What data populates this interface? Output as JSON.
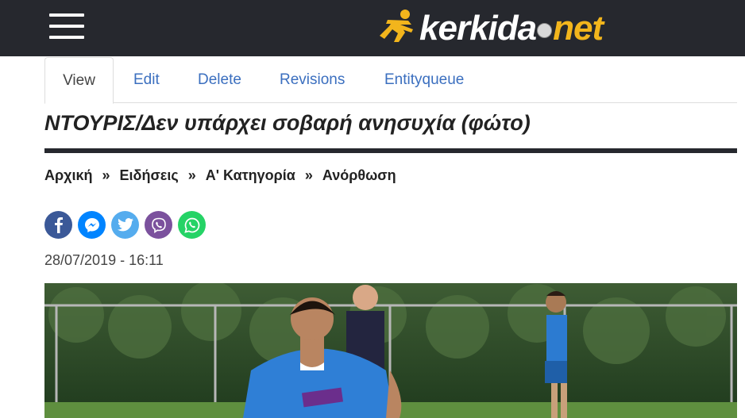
{
  "header": {
    "logo": {
      "part1": "kerkida",
      "part2": "net"
    },
    "menu_icon": "hamburger-icon"
  },
  "tabs": [
    {
      "label": "View",
      "active": true
    },
    {
      "label": "Edit"
    },
    {
      "label": "Delete"
    },
    {
      "label": "Revisions"
    },
    {
      "label": "Entityqueue"
    }
  ],
  "article": {
    "title": "ΝΤΟΥΡΙΣ/Δεν υπάρχει σοβαρή ανησυχία (φώτο)",
    "date": "28/07/2019 - 16:11"
  },
  "breadcrumb": {
    "items": [
      "Αρχική",
      "Ειδήσεις",
      "Α' Κατηγορία",
      "Ανόρθωση"
    ],
    "separator": "»"
  },
  "share": {
    "buttons": [
      {
        "icon": "facebook-icon",
        "color": "#3b5998"
      },
      {
        "icon": "messenger-icon",
        "color": "#0084ff"
      },
      {
        "icon": "twitter-icon",
        "color": "#55acee"
      },
      {
        "icon": "viber-icon",
        "color": "#7b519d"
      },
      {
        "icon": "whatsapp-icon",
        "color": "#25d366"
      }
    ]
  },
  "colors": {
    "header_bg": "#26282e",
    "link": "#3b6fbf",
    "logo_accent": "#f2b51c"
  }
}
